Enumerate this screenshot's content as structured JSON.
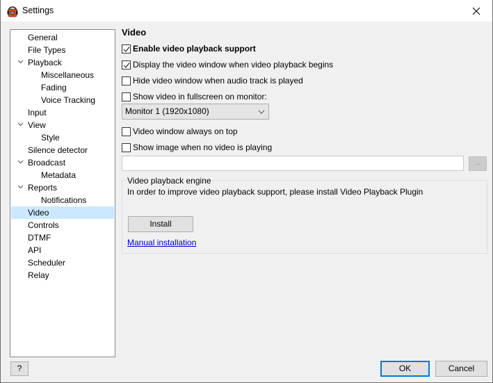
{
  "window": {
    "title": "Settings",
    "app_icon": "headphones-speaker-icon",
    "close_icon": "close-icon"
  },
  "tree": {
    "items": [
      {
        "label": "General",
        "level": 0,
        "expanded": null,
        "selected": false
      },
      {
        "label": "File Types",
        "level": 0,
        "expanded": null,
        "selected": false
      },
      {
        "label": "Playback",
        "level": 0,
        "expanded": true,
        "selected": false
      },
      {
        "label": "Miscellaneous",
        "level": 1,
        "expanded": null,
        "selected": false
      },
      {
        "label": "Fading",
        "level": 1,
        "expanded": null,
        "selected": false
      },
      {
        "label": "Voice Tracking",
        "level": 1,
        "expanded": null,
        "selected": false
      },
      {
        "label": "Input",
        "level": 0,
        "expanded": null,
        "selected": false
      },
      {
        "label": "View",
        "level": 0,
        "expanded": true,
        "selected": false
      },
      {
        "label": "Style",
        "level": 1,
        "expanded": null,
        "selected": false
      },
      {
        "label": "Silence detector",
        "level": 0,
        "expanded": null,
        "selected": false
      },
      {
        "label": "Broadcast",
        "level": 0,
        "expanded": true,
        "selected": false
      },
      {
        "label": "Metadata",
        "level": 1,
        "expanded": null,
        "selected": false
      },
      {
        "label": "Reports",
        "level": 0,
        "expanded": true,
        "selected": false
      },
      {
        "label": "Notifications",
        "level": 1,
        "expanded": null,
        "selected": false
      },
      {
        "label": "Video",
        "level": 0,
        "expanded": null,
        "selected": true
      },
      {
        "label": "Controls",
        "level": 0,
        "expanded": null,
        "selected": false
      },
      {
        "label": "DTMF",
        "level": 0,
        "expanded": null,
        "selected": false
      },
      {
        "label": "API",
        "level": 0,
        "expanded": null,
        "selected": false
      },
      {
        "label": "Scheduler",
        "level": 0,
        "expanded": null,
        "selected": false
      },
      {
        "label": "Relay",
        "level": 0,
        "expanded": null,
        "selected": false
      }
    ],
    "selected_bg": "#cce8ff"
  },
  "video": {
    "section_title": "Video",
    "enable_playback": {
      "label": "Enable video playback support",
      "checked": true
    },
    "display_window": {
      "label": "Display the video window when video playback begins",
      "checked": true
    },
    "hide_window": {
      "label": "Hide video window when audio track is played",
      "checked": false
    },
    "fullscreen": {
      "label": "Show video in fullscreen on monitor:",
      "checked": false
    },
    "monitor_select": {
      "value": "Monitor 1 (1920x1080)"
    },
    "always_on_top": {
      "label": "Video window always on top",
      "checked": false
    },
    "show_image": {
      "label": "Show image when no video is playing",
      "checked": false
    },
    "image_path": {
      "value": "",
      "browse_label": "..."
    },
    "engine": {
      "legend": "Video playback engine",
      "message": "In order to improve video playback support, please install Video Playback Plugin",
      "install_label": "Install",
      "manual_link": "Manual installation"
    }
  },
  "footer": {
    "help_label": "?",
    "ok_label": "OK",
    "cancel_label": "Cancel",
    "accent": "#0078d7"
  }
}
